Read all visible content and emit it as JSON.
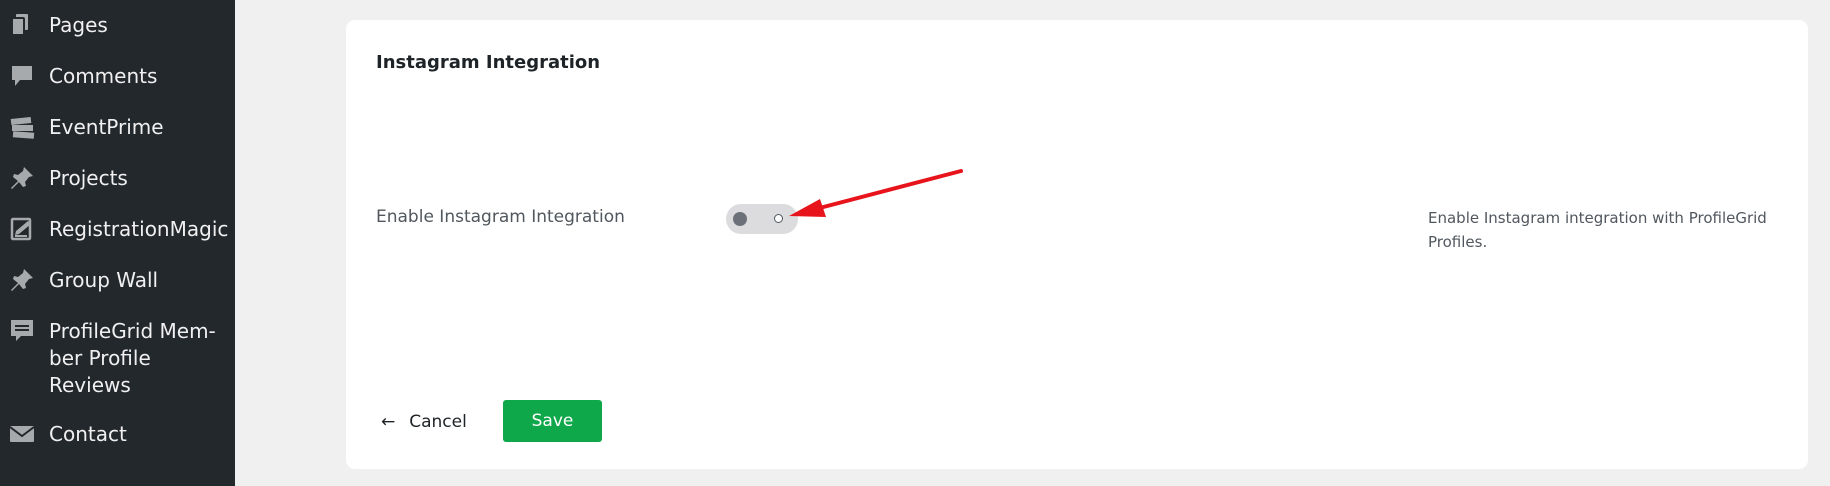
{
  "sidebar": {
    "items": [
      {
        "label": "Pages",
        "icon": "pages-icon"
      },
      {
        "label": "Comments",
        "icon": "comments-icon"
      },
      {
        "label": "EventPrime",
        "icon": "tickets-icon"
      },
      {
        "label": "Projects",
        "icon": "pushpin-icon"
      },
      {
        "label": "RegistrationMagic",
        "icon": "forms-icon"
      },
      {
        "label": "Group Wall",
        "icon": "pushpin-icon"
      },
      {
        "label_lines": [
          "ProfileGrid Mem-",
          "ber Profile",
          "Reviews"
        ],
        "icon": "feedback-icon"
      },
      {
        "label": "Contact",
        "icon": "email-icon"
      }
    ]
  },
  "card": {
    "title": "Instagram Integration",
    "field_label": "Enable Instagram Integration",
    "toggle_state": "off",
    "help_text": "Enable Instagram integration with ProfileGrid Profiles."
  },
  "actions": {
    "cancel_arrow": "←",
    "cancel_label": "Cancel",
    "save_label": "Save"
  },
  "colors": {
    "sidebar_bg": "#23282d",
    "page_bg": "#f0f0f1",
    "save_green": "#0ea84a",
    "annotation_arrow": "#e8141c"
  }
}
